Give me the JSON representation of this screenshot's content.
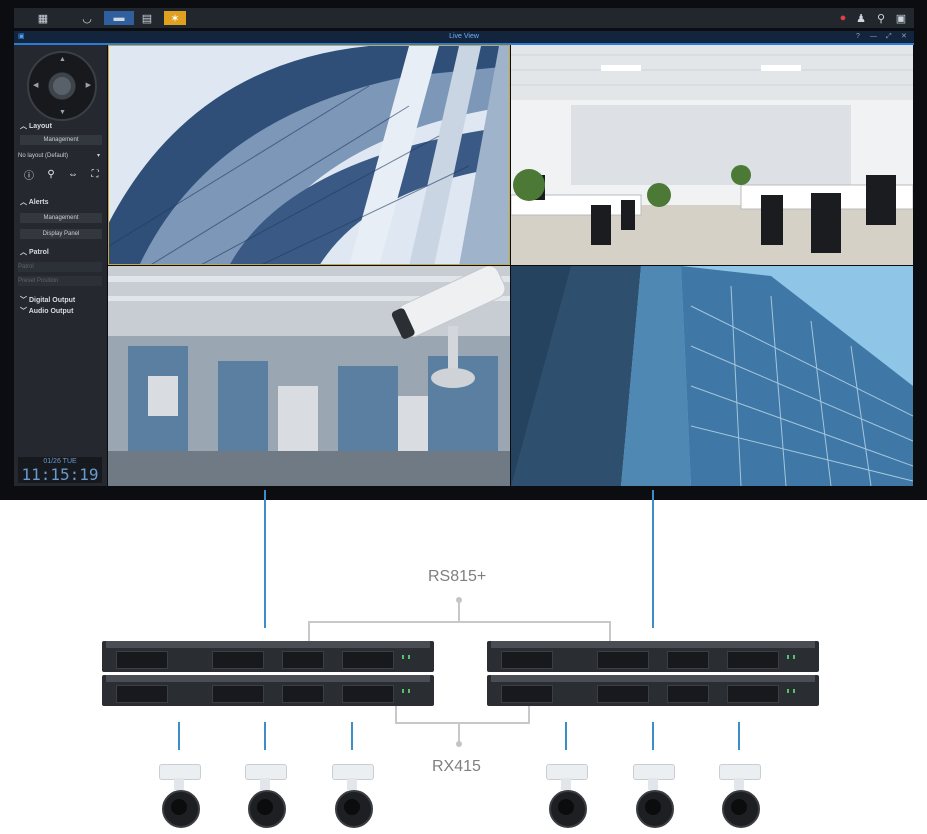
{
  "window": {
    "title": "Live View",
    "controls": [
      "?",
      "—",
      "⤢",
      "✕"
    ]
  },
  "taskbar": {
    "icons": [
      "grid-icon",
      "shield-icon",
      "live-view-icon",
      "timeline-icon",
      "image-icon"
    ],
    "right_icons": [
      "notification-icon",
      "user-icon",
      "search-icon",
      "window-icon"
    ]
  },
  "sidebar": {
    "layout_header": "Layout",
    "layout_management": "Management",
    "layout_select": "No layout (Default)",
    "alerts_header": "Alerts",
    "alerts_management": "Management",
    "alerts_display_panel": "Display Panel",
    "patrol_header": "Patrol",
    "patrol_select": "Patrol",
    "preset_select": "Preset Position",
    "digital_output": "Digital Output",
    "audio_output": "Audio Output",
    "clock_date": "01/26 TUE",
    "clock_time": "11:15:19"
  },
  "diagram": {
    "top_device": "RS815+",
    "bottom_device": "RX415"
  },
  "colors": {
    "accent": "#2d7bd6",
    "connector": "#3d8ec8",
    "bracket": "#c8c8c8"
  }
}
